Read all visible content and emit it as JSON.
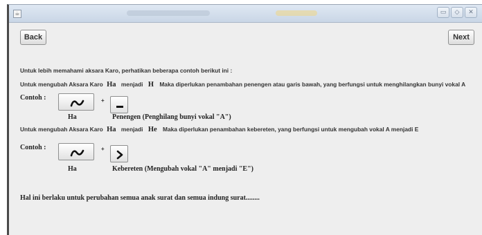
{
  "window": {
    "app_icon": "java-app-icon",
    "controls": [
      "minimize-icon",
      "maximize-icon",
      "close-icon"
    ]
  },
  "toolbar": {
    "back_label": "Back",
    "next_label": "Next"
  },
  "lesson": {
    "intro": "Untuk lebih memahami aksara Karo, perhatikan beberapa contoh berikut ini :",
    "example1": {
      "sentence_prefix": "Untuk mengubah Aksara Karo",
      "from": "Ha",
      "middle": "menjadi",
      "to": "H",
      "sentence_suffix": "Maka diperlukan penambahan penengen atau garis bawah, yang berfungsi untuk menghilangkan bunyi vokal A",
      "contoh_label": "Contoh :",
      "glyph_label": "Ha",
      "mark_label": "Penengen (Penghilang bunyi vokal \"A\")",
      "plus": "+"
    },
    "example2": {
      "sentence_prefix": "Untuk mengubah Aksara Karo",
      "from": "Ha",
      "middle": "menjadi",
      "to": "He",
      "sentence_suffix": "Maka diperlukan penambahan kebereten, yang berfungsi untuk mengubah vokal A menjadi E",
      "contoh_label": "Contoh :",
      "glyph_label": "Ha",
      "mark_label": "Kebereten (Mengubah vokal \"A\" menjadi \"E\")",
      "plus": "+"
    },
    "footer": "Hal ini berlaku untuk perubahan semua anak surat dan semua indung surat........"
  }
}
